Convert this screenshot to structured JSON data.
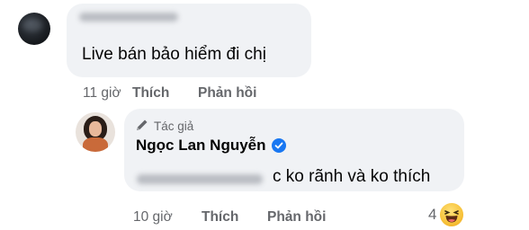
{
  "comment": {
    "text": "Live bán bảo hiểm đi chị",
    "time": "11 giờ",
    "like_label": "Thích",
    "reply_label": "Phản hồi"
  },
  "reply": {
    "author_badge": "Tác giả",
    "author_name": "Ngọc Lan Nguyễn",
    "text": "c ko rãnh và ko thích",
    "time": "10 giờ",
    "like_label": "Thích",
    "reply_label": "Phản hồi",
    "reaction_count": "4",
    "reaction_icon": "haha-icon"
  },
  "colors": {
    "bubble": "#f0f2f5",
    "muted_text": "#65676b",
    "verified": "#1877f2"
  }
}
